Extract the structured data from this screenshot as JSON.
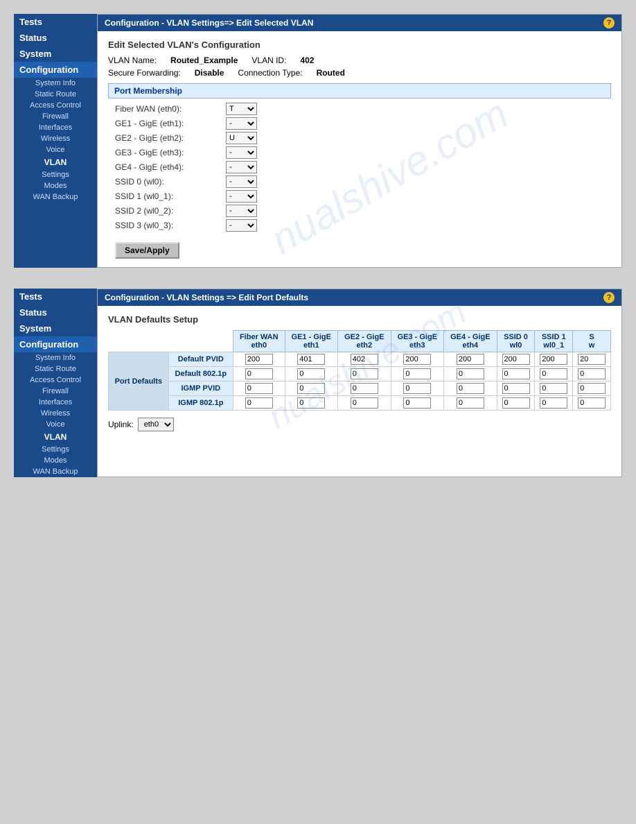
{
  "panel1": {
    "header": "Configuration - VLAN Settings=> Edit Selected VLAN",
    "section_title": "Edit Selected VLAN's Configuration",
    "vlan_name_label": "VLAN Name:",
    "vlan_name_value": "Routed_Example",
    "vlan_id_label": "VLAN ID:",
    "vlan_id_value": "402",
    "secure_forwarding_label": "Secure Forwarding:",
    "secure_forwarding_value": "Disable",
    "connection_type_label": "Connection Type:",
    "connection_type_value": "Routed",
    "port_membership_label": "Port Membership",
    "ports": [
      {
        "label": "Fiber WAN (eth0):",
        "value": "T"
      },
      {
        "label": "GE1 - GigE (eth1):",
        "value": "-"
      },
      {
        "label": "GE2 - GigE (eth2):",
        "value": "U"
      },
      {
        "label": "GE3 - GigE (eth3):",
        "value": "-"
      },
      {
        "label": "GE4 - GigE (eth4):",
        "value": "-"
      },
      {
        "label": "SSID 0 (wl0):",
        "value": "-"
      },
      {
        "label": "SSID 1 (wl0_1):",
        "value": "-"
      },
      {
        "label": "SSID 2 (wl0_2):",
        "value": "-"
      },
      {
        "label": "SSID 3 (wl0_3):",
        "value": "-"
      }
    ],
    "save_button_label": "Save/Apply"
  },
  "panel2": {
    "header": "Configuration - VLAN Settings => Edit Port Defaults",
    "section_title": "VLAN Defaults Setup",
    "columns": [
      "Fiber WAN eth0",
      "GE1 - GigE eth1",
      "GE2 - GigE eth2",
      "GE3 - GigE eth3",
      "GE4 - GigE eth4",
      "SSID 0 wl0",
      "SSID 1 wl0_1",
      "S w"
    ],
    "port_defaults_label": "Port Defaults",
    "rows": [
      {
        "label": "Default PVID",
        "values": [
          "200",
          "401",
          "402",
          "200",
          "200",
          "200",
          "200",
          "20"
        ]
      },
      {
        "label": "Default 802.1p",
        "values": [
          "0",
          "0",
          "0",
          "0",
          "0",
          "0",
          "0",
          "0"
        ]
      },
      {
        "label": "IGMP PVID",
        "values": [
          "0",
          "0",
          "0",
          "0",
          "0",
          "0",
          "0",
          "0"
        ]
      },
      {
        "label": "IGMP 802.1p",
        "values": [
          "0",
          "0",
          "0",
          "0",
          "0",
          "0",
          "0",
          "0"
        ]
      }
    ],
    "uplink_label": "Uplink:",
    "uplink_value": "eth0"
  },
  "sidebar": {
    "items": [
      {
        "label": "Tests"
      },
      {
        "label": "Status"
      },
      {
        "label": "System"
      },
      {
        "label": "Configuration",
        "active": true
      },
      {
        "label": "System Info",
        "sub": true
      },
      {
        "label": "Static Route",
        "sub": true
      },
      {
        "label": "Access Control",
        "sub": true
      },
      {
        "label": "Firewall",
        "sub": true
      },
      {
        "label": "Interfaces",
        "sub": true
      },
      {
        "label": "Wireless",
        "sub": true
      },
      {
        "label": "Voice",
        "sub": true
      },
      {
        "label": "VLAN",
        "sub": true,
        "group": true
      },
      {
        "label": "Settings",
        "sub2": true
      },
      {
        "label": "Modes",
        "sub2": true
      },
      {
        "label": "WAN Backup",
        "sub2": true
      }
    ]
  }
}
